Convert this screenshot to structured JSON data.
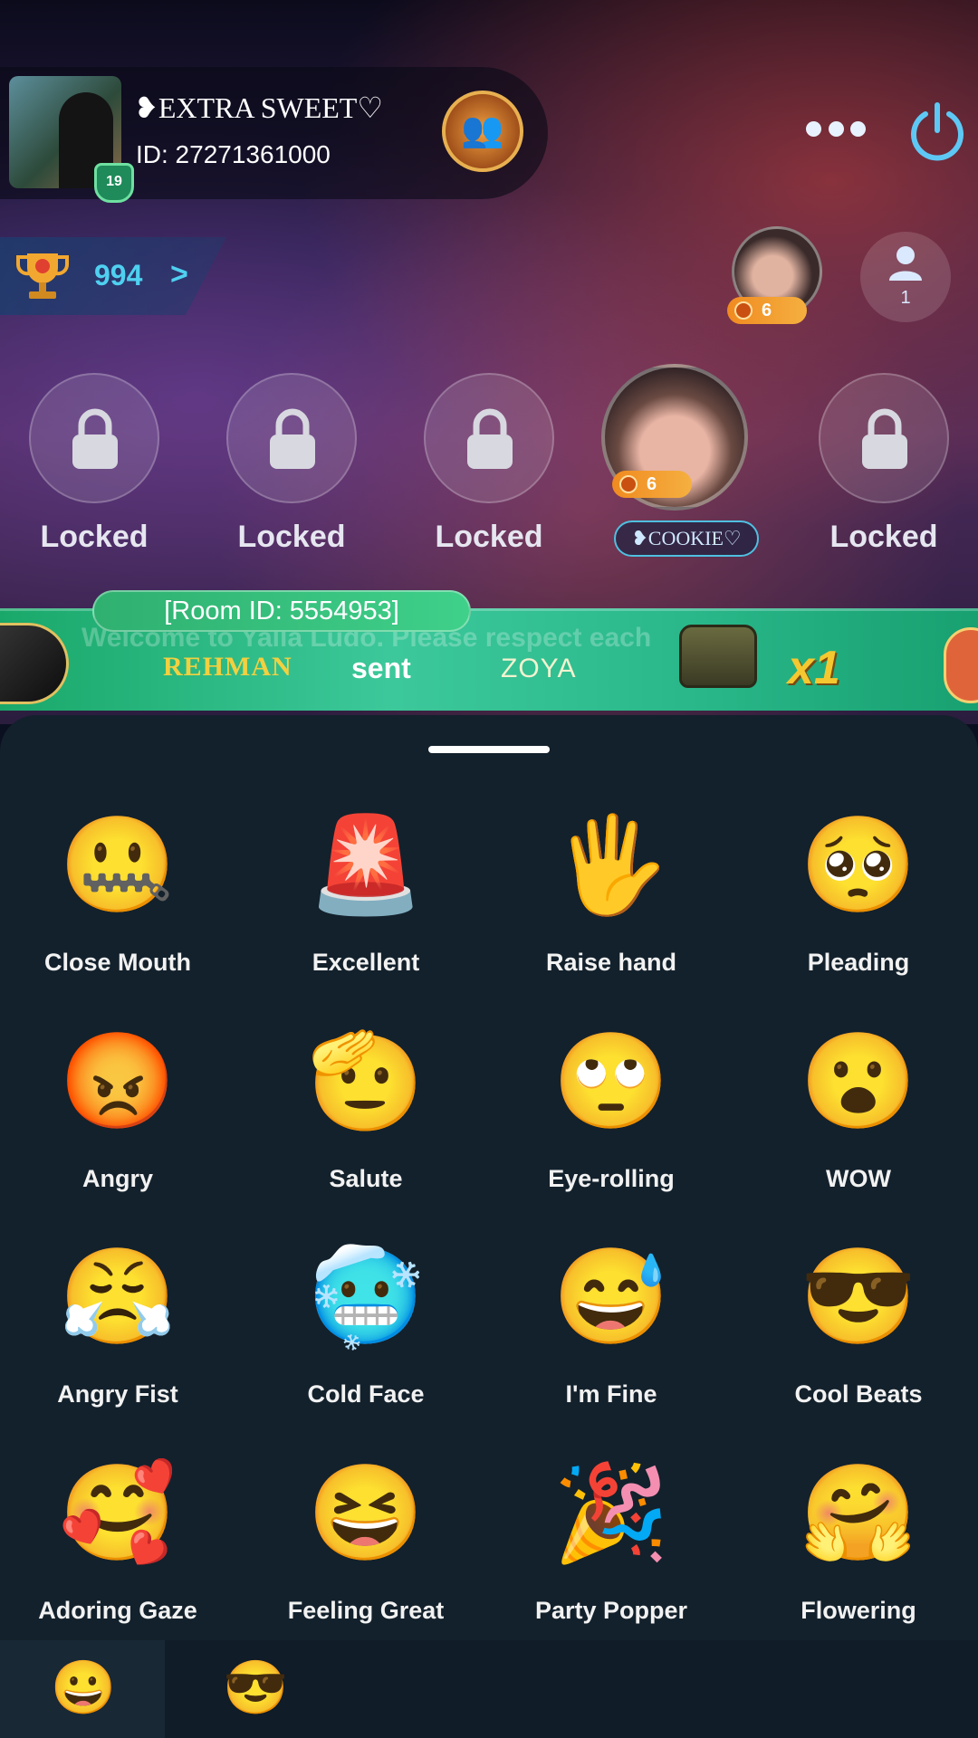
{
  "user": {
    "name": "❥EXTRA SWEET♡",
    "id": "ID: 27271361000",
    "level": "19"
  },
  "trophy": {
    "count": "994",
    "arrow": ">"
  },
  "host": {
    "badge": "6"
  },
  "audience": {
    "count": "1"
  },
  "seats": [
    {
      "label": "Locked"
    },
    {
      "label": "Locked"
    },
    {
      "label": "Locked"
    },
    {
      "label": "❥COOKIE♡",
      "badge": "6"
    },
    {
      "label": "Locked"
    }
  ],
  "banner": {
    "room_id": "[Room ID: 5554953]",
    "ghost_text": "Welcome to Yalla Ludo. Please respect each",
    "sender": "REHMAN",
    "sent": "sent",
    "receiver": "ZOYA",
    "multiplier": "x1"
  },
  "emojis": [
    {
      "char": "🤐",
      "label": "Close Mouth"
    },
    {
      "char": "🚨",
      "label": "Excellent"
    },
    {
      "char": "🖐",
      "label": "Raise hand"
    },
    {
      "char": "🥺",
      "label": "Pleading"
    },
    {
      "char": "😡",
      "label": "Angry"
    },
    {
      "char": "🫡",
      "label": "Salute"
    },
    {
      "char": "🙄",
      "label": "Eye-rolling"
    },
    {
      "char": "😮",
      "label": "WOW"
    },
    {
      "char": "😤",
      "label": "Angry Fist"
    },
    {
      "char": "🥶",
      "label": "Cold Face"
    },
    {
      "char": "😅",
      "label": "I'm Fine"
    },
    {
      "char": "😎",
      "label": "Cool Beats"
    },
    {
      "char": "🥰",
      "label": "Adoring Gaze"
    },
    {
      "char": "😆",
      "label": "Feeling Great"
    },
    {
      "char": "🎉",
      "label": "Party Popper"
    },
    {
      "char": "🤗",
      "label": "Flowering"
    }
  ],
  "tabs": [
    {
      "char": "😀",
      "icon": "smile-tab-icon"
    },
    {
      "char": "😎",
      "icon": "cool-tab-icon"
    }
  ],
  "colors": {
    "accent": "#4fd0f0",
    "banner": "#2ab88a",
    "sheet": "#13212c",
    "badge": "#f5a030"
  }
}
